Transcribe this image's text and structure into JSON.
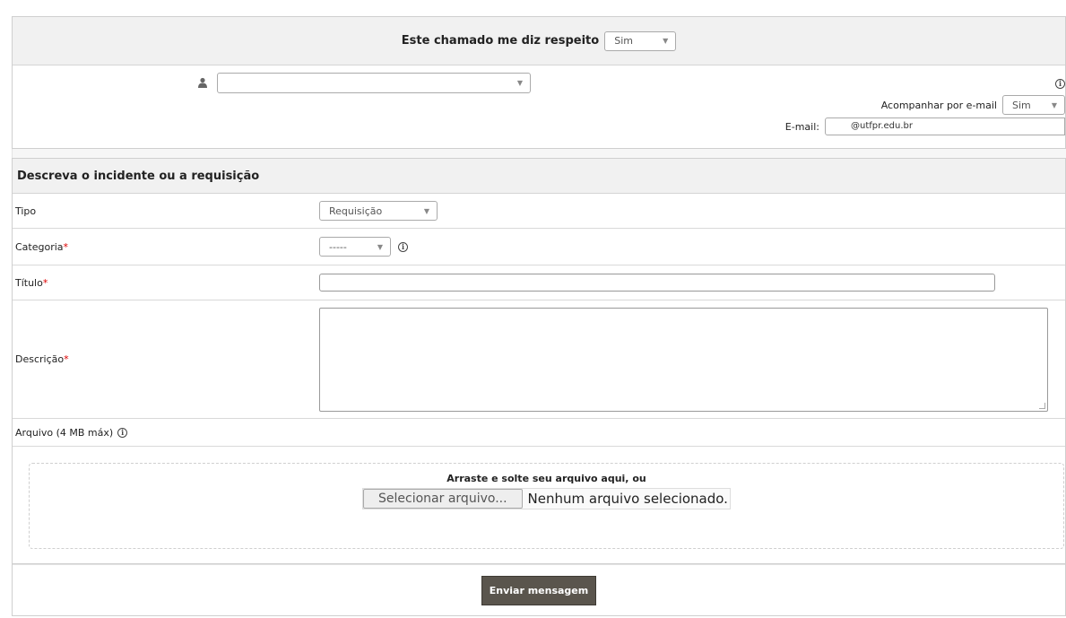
{
  "concern": {
    "label": "Este chamado me diz respeito",
    "value": "Sim"
  },
  "requester": {
    "user_icon": "user-icon",
    "info_icon": "info-icon",
    "follow_label": "Acompanhar por e-mail",
    "follow_value": "Sim",
    "email_label": "E-mail:",
    "email_value": "@utfpr.edu.br"
  },
  "form": {
    "section_title": "Descreva o incidente ou a requisição",
    "tipo_label": "Tipo",
    "tipo_value": "Requisição",
    "categoria_label": "Categoria",
    "categoria_value": "-----",
    "titulo_label": "Título",
    "descricao_label": "Descrição",
    "required_mark": "*"
  },
  "upload": {
    "label": "Arquivo (4 MB máx)",
    "drop_text": "Arraste e solte seu arquivo aqui, ou",
    "button_label": "Selecionar arquivo...",
    "status": "Nenhum arquivo selecionado."
  },
  "submit": {
    "label": "Enviar mensagem"
  },
  "colors": {
    "header_bg": "#f1f1f1",
    "submit_bg": "#5a554d",
    "required": "#dd0000"
  }
}
